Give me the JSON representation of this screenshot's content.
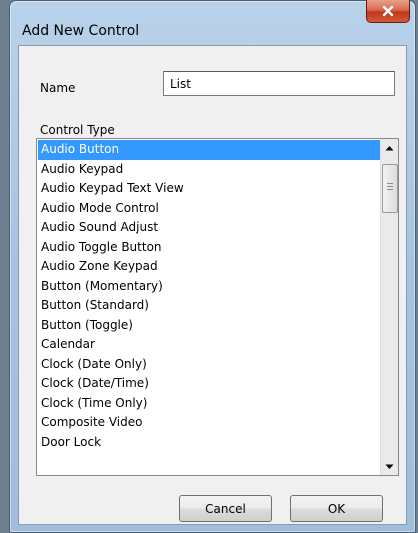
{
  "window": {
    "title": "Add New Control",
    "close_icon": "close-icon"
  },
  "form": {
    "name_label": "Name",
    "name_value": "List",
    "control_type_label": "Control Type"
  },
  "control_types": {
    "selected_index": 0,
    "items": [
      "Audio Button",
      "Audio Keypad",
      "Audio Keypad Text View",
      "Audio Mode Control",
      "Audio Sound Adjust",
      "Audio Toggle Button",
      "Audio Zone Keypad",
      "Button (Momentary)",
      "Button (Standard)",
      "Button (Toggle)",
      "Calendar",
      "Clock (Date Only)",
      "Clock (Date/Time)",
      "Clock (Time Only)",
      "Composite Video",
      "Door Lock"
    ]
  },
  "buttons": {
    "cancel": "Cancel",
    "ok": "OK"
  },
  "colors": {
    "selection": "#3399ff",
    "close_button": "#c2381c"
  }
}
